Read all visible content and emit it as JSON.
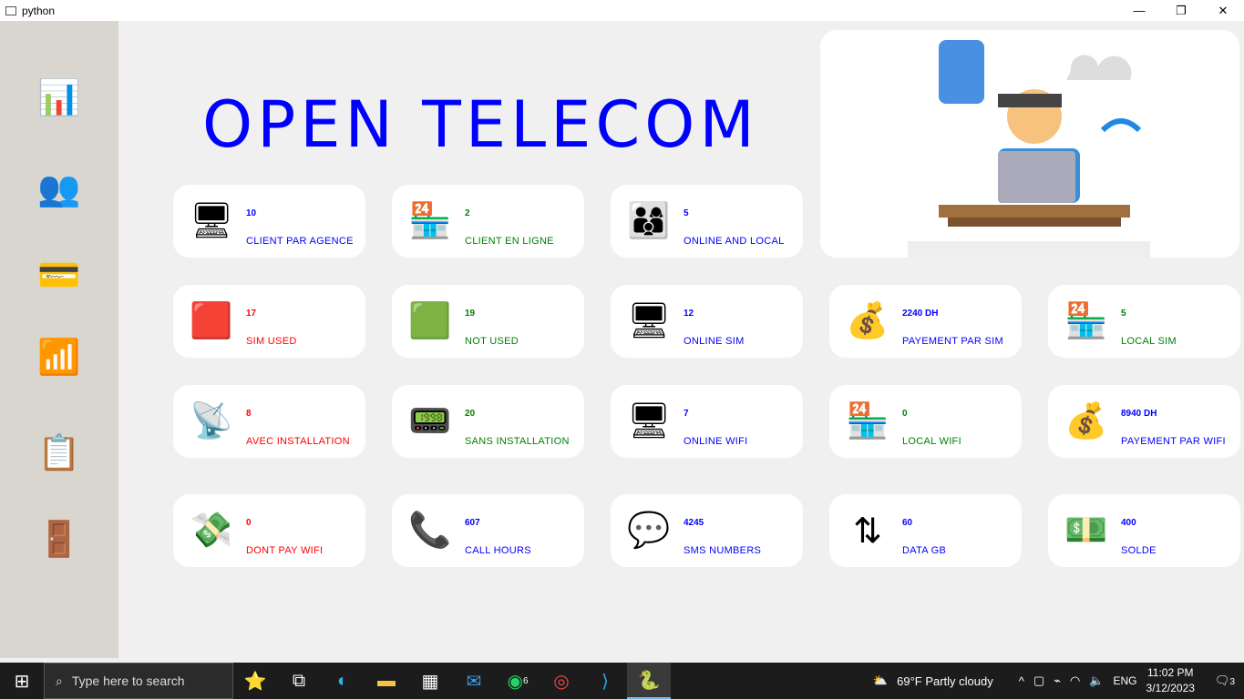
{
  "window": {
    "title": "python",
    "minimize": "—",
    "maximize": "❐",
    "close": "✕"
  },
  "header": {
    "title": "OPEN TELECOM"
  },
  "colors": {
    "blue": "#0000ff",
    "green": "#008000",
    "red": "#ff0000"
  },
  "sidebar": {
    "items": [
      {
        "icon": "dashboard-chart-icon",
        "glyph": "📊"
      },
      {
        "icon": "users-icon",
        "glyph": "👥"
      },
      {
        "icon": "sim-card-icon",
        "glyph": "💳"
      },
      {
        "icon": "wifi-icon",
        "glyph": "📶"
      },
      {
        "icon": "report-icon",
        "glyph": "📋"
      },
      {
        "icon": "logout-icon",
        "glyph": "🚪"
      }
    ]
  },
  "cards": [
    {
      "value": "10",
      "label": "CLIENT PAR AGENCE",
      "color": "blue",
      "icon": "monitor-icon",
      "glyph": "🖥"
    },
    {
      "value": "2",
      "label": "CLIENT EN LIGNE",
      "color": "green",
      "icon": "store-location-icon",
      "glyph": "🏪"
    },
    {
      "value": "5",
      "label": "ONLINE AND LOCAL",
      "color": "blue",
      "icon": "people-icon",
      "glyph": "👨‍👩‍👦"
    },
    {
      "value": "17",
      "label": "SIM USED",
      "color": "red",
      "icon": "sim-red-icon",
      "glyph": "🟥"
    },
    {
      "value": "19",
      "label": "NOT USED",
      "color": "green",
      "icon": "sim-green-icon",
      "glyph": "🟩"
    },
    {
      "value": "12",
      "label": "ONLINE SIM",
      "color": "blue",
      "icon": "monitor-icon",
      "glyph": "🖥"
    },
    {
      "value": "2240 DH",
      "label": "PAYEMENT PAR SIM",
      "color": "blue",
      "icon": "money-bag-icon",
      "glyph": "💰"
    },
    {
      "value": "5",
      "label": "LOCAL SIM",
      "color": "green",
      "icon": "store-location-icon",
      "glyph": "🏪"
    },
    {
      "value": "8",
      "label": "AVEC INSTALLATION",
      "color": "red",
      "icon": "router-icon",
      "glyph": "📡"
    },
    {
      "value": "20",
      "label": "SANS INSTALLATION",
      "color": "green",
      "icon": "modem-icon",
      "glyph": "📟"
    },
    {
      "value": "7",
      "label": "ONLINE WIFI",
      "color": "blue",
      "icon": "monitor-icon",
      "glyph": "🖥"
    },
    {
      "value": "0",
      "label": "LOCAL WIFI",
      "color": "green",
      "icon": "store-location-icon",
      "glyph": "🏪"
    },
    {
      "value": "8940 DH",
      "label": "PAYEMENT PAR WIFI",
      "color": "blue",
      "icon": "money-bag-icon",
      "glyph": "💰"
    },
    {
      "value": "0",
      "label": "DONT PAY WIFI",
      "color": "red",
      "icon": "payment-hand-icon",
      "glyph": "💸"
    },
    {
      "value": "607",
      "label": "CALL HOURS",
      "color": "blue",
      "icon": "phone-icon",
      "glyph": "📞"
    },
    {
      "value": "4245",
      "label": "SMS NUMBERS",
      "color": "blue",
      "icon": "sms-icon",
      "glyph": "💬"
    },
    {
      "value": "60",
      "label": "DATA GB",
      "color": "blue",
      "icon": "data-arrows-icon",
      "glyph": "⇅"
    },
    {
      "value": "400",
      "label": "SOLDE",
      "color": "blue",
      "icon": "cash-icon",
      "glyph": "💵"
    }
  ],
  "taskbar": {
    "search_placeholder": "Type here to search",
    "whatsapp_badge": "6",
    "weather": "69°F  Partly cloudy",
    "lang": "ENG",
    "time": "11:02 PM",
    "date": "3/12/2023",
    "notifications": "3"
  }
}
